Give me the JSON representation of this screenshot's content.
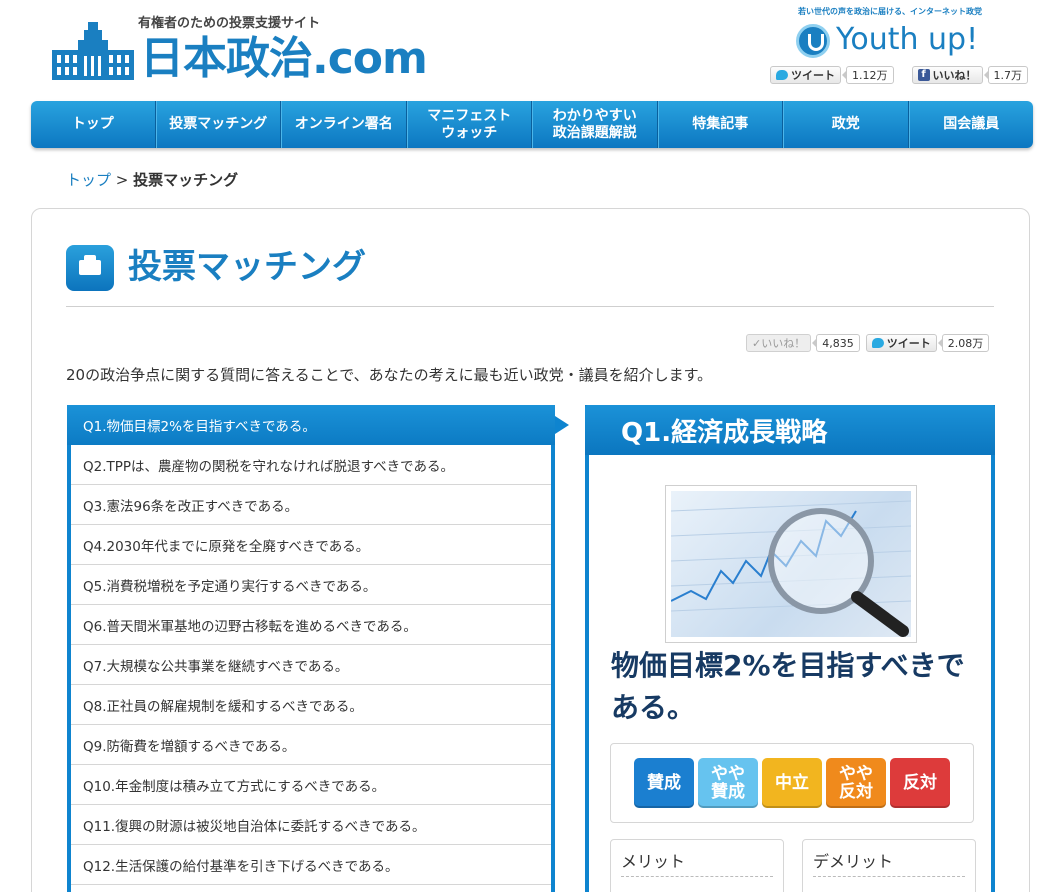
{
  "header": {
    "tagline": "有権者のための投票支援サイト",
    "logo_text": "日本政治.com",
    "youth_tagline": "若い世代の声を政治に届ける、インターネット政党",
    "youth_logo": "Youth up!",
    "tweet_label": "ツイート",
    "tweet_count": "1.12万",
    "like_label": "いいね！",
    "like_count": "1.7万"
  },
  "nav": {
    "items": [
      {
        "label": "トップ"
      },
      {
        "label": "投票マッチング"
      },
      {
        "label": "オンライン署名"
      },
      {
        "label": "マニフェスト\nウォッチ"
      },
      {
        "label": "わかりやすい\n政治課題解説"
      },
      {
        "label": "特集記事"
      },
      {
        "label": "政党"
      },
      {
        "label": "国会議員"
      }
    ]
  },
  "breadcrumb": {
    "home": "トップ",
    "separator": " > ",
    "current": "投票マッチング"
  },
  "page": {
    "title": "投票マッチング",
    "like_label": "✓いいね！",
    "like_count": "4,835",
    "tweet_label": "ツイート",
    "tweet_count": "2.08万",
    "intro": "20の政治争点に関する質問に答えることで、あなたの考えに最も近い政党・議員を紹介します。"
  },
  "questions": [
    "Q1.物価目標2%を目指すべきである。",
    "Q2.TPPは、農産物の関税を守れなければ脱退すべきである。",
    "Q3.憲法96条を改正すべきである。",
    "Q4.2030年代までに原発を全廃すべきである。",
    "Q5.消費税増税を予定通り実行するべきである。",
    "Q6.普天間米軍基地の辺野古移転を進めるべきである。",
    "Q7.大規模な公共事業を継続すべきである。",
    "Q8.正社員の解雇規制を緩和するべきである。",
    "Q9.防衛費を増額するべきである。",
    "Q10.年金制度は積み立て方式にするべきである。",
    "Q11.復興の財源は被災地自治体に委託するべきである。",
    "Q12.生活保護の給付基準を引き下げるべきである。"
  ],
  "detail": {
    "heading": "Q1.経済成長戦略",
    "question": "物価目標2%を目指すべきである。",
    "votes": [
      {
        "label": "賛成",
        "color": "#1b7fd0"
      },
      {
        "label": "やや\n賛成",
        "color": "#66c3ef"
      },
      {
        "label": "中立",
        "color": "#f2b51f"
      },
      {
        "label": "やや\n反対",
        "color": "#f08a1c"
      },
      {
        "label": "反対",
        "color": "#dd3b3b"
      }
    ],
    "pros_title": "メリット",
    "cons_title": "デメリット"
  }
}
